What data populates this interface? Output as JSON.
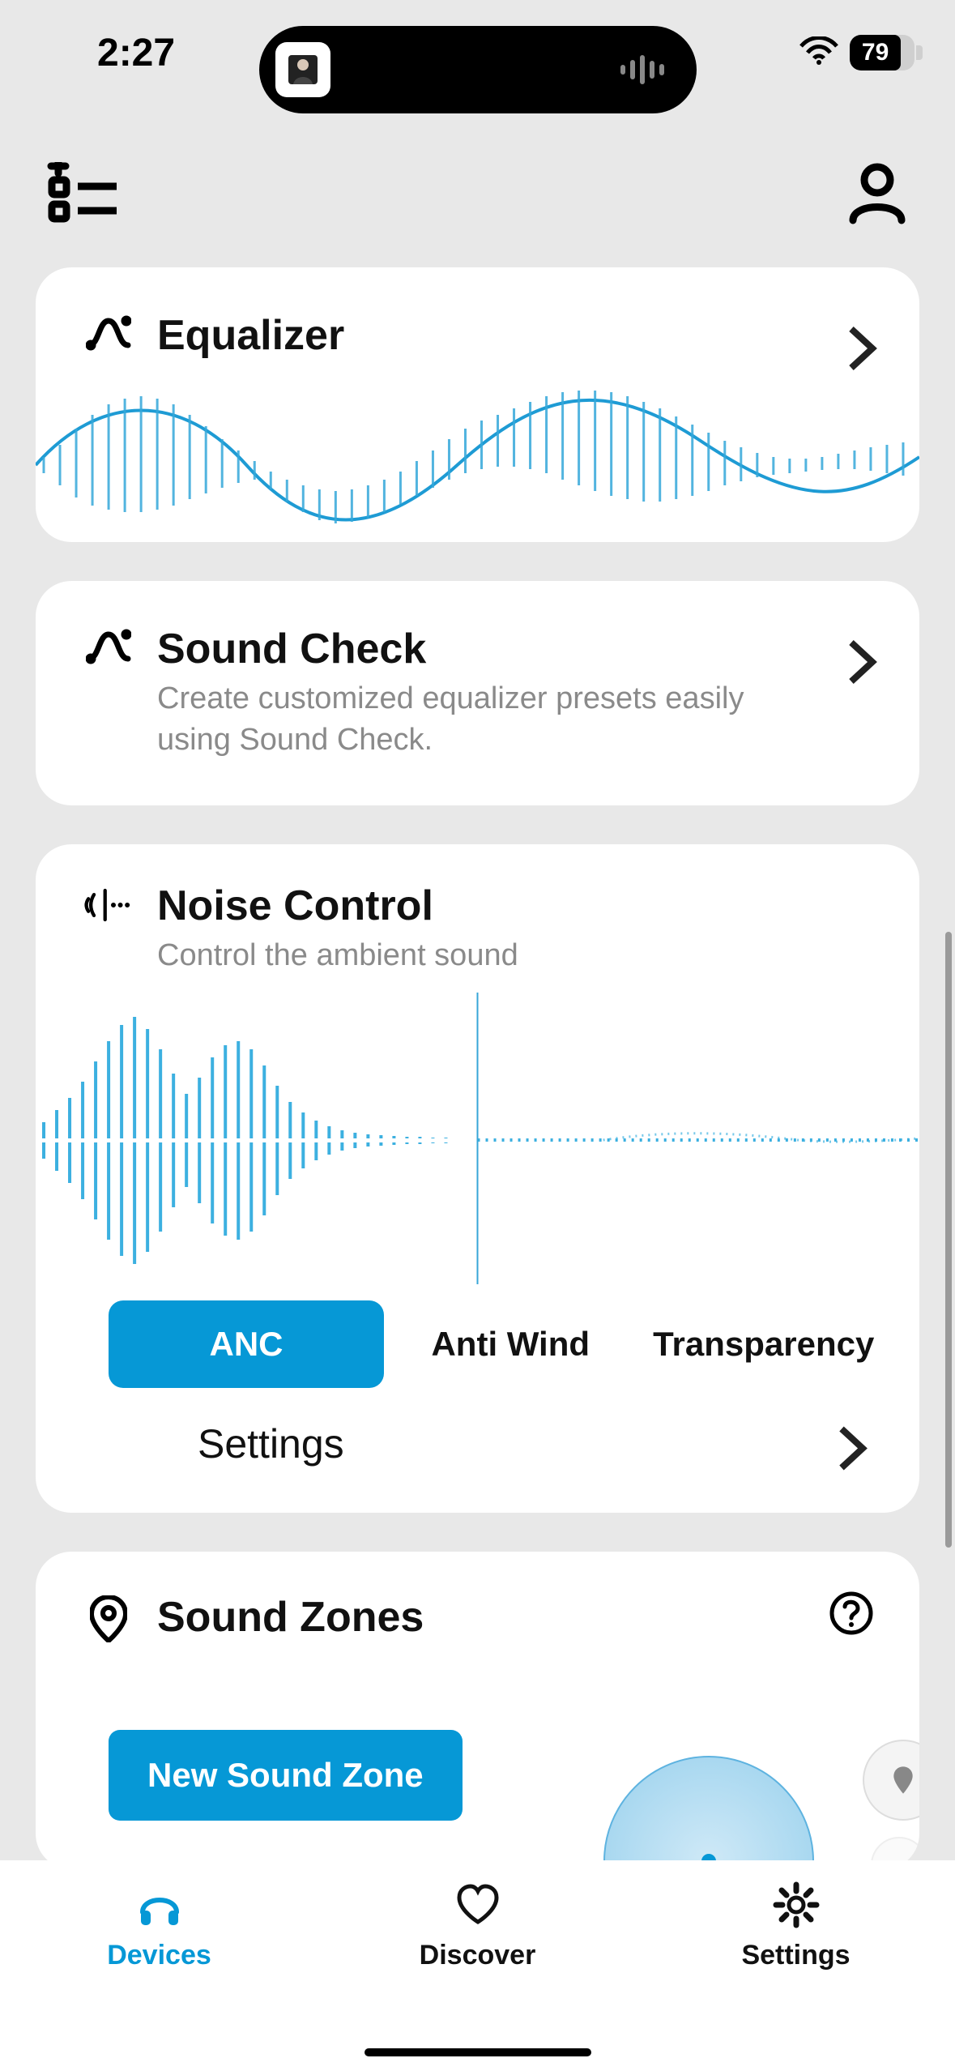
{
  "status": {
    "time": "2:27",
    "battery_pct": "79"
  },
  "cards": {
    "equalizer": {
      "title": "Equalizer"
    },
    "sound_check": {
      "title": "Sound Check",
      "subtitle": "Create customized equalizer presets easily using Sound Check."
    },
    "noise_control": {
      "title": "Noise Control",
      "subtitle": "Control the ambient sound",
      "modes": {
        "anc": "ANC",
        "anti_wind": "Anti Wind",
        "transparency": "Transparency"
      },
      "settings_label": "Settings"
    },
    "sound_zones": {
      "title": "Sound Zones",
      "new_button": "New Sound Zone"
    }
  },
  "tabs": {
    "devices": "Devices",
    "discover": "Discover",
    "settings": "Settings"
  },
  "colors": {
    "accent": "#0698d6",
    "bg": "#e8e8e8"
  }
}
